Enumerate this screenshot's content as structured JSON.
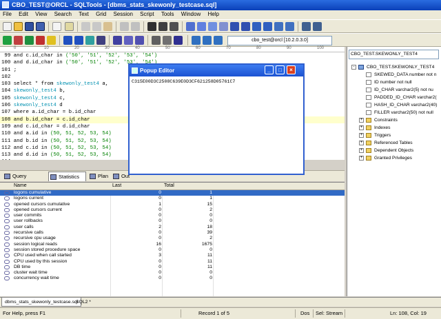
{
  "window": {
    "title": "CBO_TEST@ORCL - SQLTools - [dbms_stats_skewonly_testcase.sql]"
  },
  "menu": [
    "File",
    "Edit",
    "View",
    "Search",
    "Text",
    "Grid",
    "Session",
    "Script",
    "Tools",
    "Window",
    "Help"
  ],
  "toolbar": {
    "connection": "cbo_test@orcl [10.2.0.3.0]"
  },
  "ruler": [
    "0",
    "10",
    "20",
    "30",
    "40",
    "50",
    "60",
    "70",
    "80",
    "90",
    "100"
  ],
  "editor": {
    "lines": [
      {
        "num": " 99",
        "parts": [
          " and c.id_char in ",
          "('50', '51', '52', '53', '54')"
        ]
      },
      {
        "num": "100",
        "parts": [
          " and d.id_char in ",
          "('50', '51', '52', '53', '54')"
        ]
      },
      {
        "num": "101",
        "parts": [
          " ;",
          ""
        ]
      },
      {
        "num": "102",
        "parts": [
          "",
          ""
        ]
      },
      {
        "num": "103",
        "parts": [
          " select * from ",
          "skewonly_test4",
          " a,"
        ]
      },
      {
        "num": "104",
        "parts": [
          " ",
          "skewonly_test4",
          " b,"
        ]
      },
      {
        "num": "105",
        "parts": [
          " ",
          "skewonly_test4",
          " c,"
        ]
      },
      {
        "num": "106",
        "parts": [
          " ",
          "skewonly_test4",
          " d"
        ]
      },
      {
        "num": "107",
        "parts": [
          " where a.id_char = b.id_char",
          "",
          ""
        ]
      },
      {
        "num": "108",
        "parts": [
          " and b.id_char = c.id_char",
          "",
          ""
        ]
      },
      {
        "num": "109",
        "parts": [
          " and c.id_char = d.id_char",
          "",
          ""
        ]
      },
      {
        "num": "110",
        "parts": [
          " and a.id in ",
          "(50, 51, 52, 53, 54)",
          ""
        ]
      },
      {
        "num": "111",
        "parts": [
          " and b.id in ",
          "(50, 51, 52, 53, 54)",
          ""
        ]
      },
      {
        "num": "112",
        "parts": [
          " and c.id in ",
          "(50, 51, 52, 53, 54)",
          ""
        ]
      },
      {
        "num": "113",
        "parts": [
          " and d.id in ",
          "(50, 51, 52, 53, 54)",
          ""
        ]
      },
      {
        "num": "114",
        "parts": [
          " ;",
          "",
          ""
        ]
      }
    ]
  },
  "popup": {
    "title": "Popup Editor",
    "content": "C315E00D3C2508C639E0D3CF621258D05761C7"
  },
  "object_browser": {
    "selected": "CBO_TEST.SKEWONLY_TEST4",
    "root": "CBO_TEST.SKEWONLY_TEST4",
    "columns": [
      "SKEWED_DATA  number  not n",
      "ID  number  not null",
      "ID_CHAR  varchar2(5)  not nu",
      "PADDED_ID_CHAR  varchar2(",
      "HASH_ID_CHAR  varchar2(40)",
      "FILLER  varchar2(50)  not null"
    ],
    "folders": [
      "Constraints",
      "Indexes",
      "Triggers",
      "Referenced Tables",
      "Dependent Objects",
      "Granted Privileges"
    ]
  },
  "bottom_tabs": [
    "Query",
    "Statistics",
    "Plan",
    "Out"
  ],
  "stats": {
    "headers": [
      "Name",
      "Last",
      "Total"
    ],
    "rows": [
      [
        "logons cumulative",
        "0",
        "1"
      ],
      [
        "logons current",
        "0",
        "1"
      ],
      [
        "opened cursors cumulative",
        "1",
        "15"
      ],
      [
        "opened cursors current",
        "0",
        "2"
      ],
      [
        "user commits",
        "0",
        "0"
      ],
      [
        "user rollbacks",
        "0",
        "0"
      ],
      [
        "user calls",
        "2",
        "18"
      ],
      [
        "recursive calls",
        "0",
        "39"
      ],
      [
        "recursive cpu usage",
        "0",
        "2"
      ],
      [
        "session logical reads",
        "16",
        "1675"
      ],
      [
        "session stored procedure space",
        "0",
        "0"
      ],
      [
        "CPU used when call started",
        "3",
        "11"
      ],
      [
        "CPU used by this session",
        "0",
        "11"
      ],
      [
        "DB time",
        "0",
        "11"
      ],
      [
        "cluster wait time",
        "0",
        "0"
      ],
      [
        "concurrency wait time",
        "0",
        "0"
      ]
    ]
  },
  "doc_tabs": [
    "dbms_stats_skewonly_testcase.sql",
    "SQL2 *"
  ],
  "status": {
    "help": "For Help, press F1",
    "record": "Record 1 of 5",
    "mode": "Dos",
    "sel": "Sel: Stream",
    "pos": "Ln: 108, Col: 19"
  }
}
